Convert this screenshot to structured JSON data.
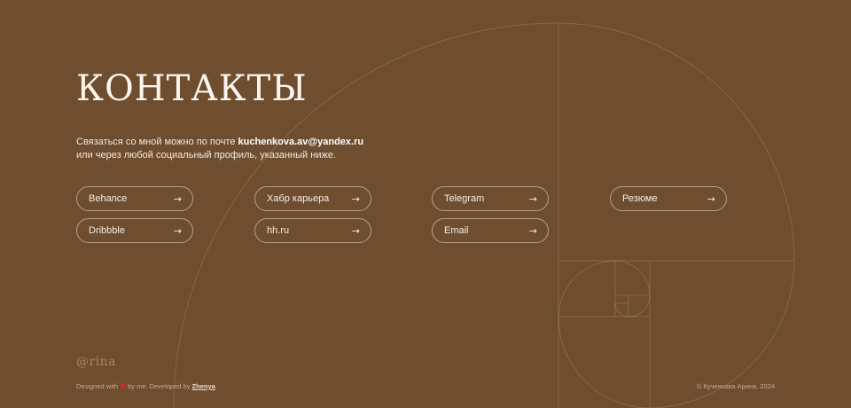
{
  "page": {
    "title": "КОНТАКТЫ",
    "intro_line1_prefix": "Связаться со мной можно по почте ",
    "email": "kuchenkova.av@yandex.ru",
    "intro_line2": "или через любой социальный профиль, указанный ниже."
  },
  "links": {
    "behance": "Behance",
    "dribbble": "Dribbble",
    "habr": "Хабр карьера",
    "hh": "hh.ru",
    "telegram": "Telegram",
    "email": "Email",
    "resume": "Резюме",
    "arrow": "→"
  },
  "footer": {
    "logo": "@rina",
    "designed_prefix": "Designed with",
    "heart": "❤",
    "designed_middle": " by me. Developed by ",
    "developer": "Zhenya",
    "designed_suffix": ".",
    "copyright": "© Кученкава Арина, 2024"
  },
  "colors": {
    "background": "#6f4e2f",
    "text": "#f5ede4",
    "accent_heart": "#e0272c"
  }
}
